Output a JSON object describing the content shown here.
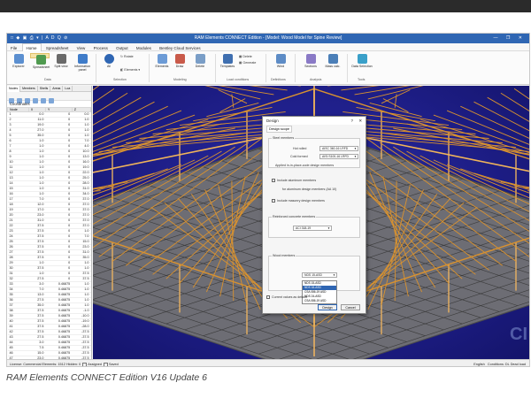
{
  "app": {
    "title": "RAM Elements CONNECT Edition - [Model: Wood Model for Spine Review]",
    "quick_access": "□ ◆ ▣ ⎙ ▾ | A D Q ⊘",
    "window_controls": "— ❐ ✕"
  },
  "menu": [
    "File",
    "Home",
    "Spreadsheet",
    "View",
    "Process",
    "Output",
    "Modules",
    "Bentley Cloud Services"
  ],
  "menu_active": "Home",
  "ribbon": {
    "buttons": [
      "Explorer",
      "Spreadsheet",
      "Split view",
      "Information panel",
      "All",
      "Elements",
      "Draw",
      "Delete",
      "Templates",
      "Add/Edit",
      "Generate",
      "Wind",
      "Sections",
      "Mass calc.",
      "Data Selection"
    ],
    "small_buttons": [
      "Rotate",
      "Elements ▾",
      "Delete",
      "Generate"
    ],
    "groups": [
      "Data",
      "Selection",
      "Modeling",
      "Load conditions",
      "Definitions",
      "Analysis",
      "Tools"
    ]
  },
  "left_panel": {
    "tabs": [
      "Nodes",
      "Members",
      "Shells",
      "Areas",
      "Loa"
    ],
    "heading": "Coordinates",
    "columns": [
      "Node",
      "X",
      "Y",
      "Z",
      "↓"
    ],
    "rows": [
      [
        "1",
        "0.0",
        "0",
        "0.0"
      ],
      [
        "2",
        "11.0",
        "0",
        "1.0"
      ],
      [
        "3",
        "19.0",
        "0",
        "1.0"
      ],
      [
        "4",
        "27.0",
        "0",
        "1.0"
      ],
      [
        "5",
        "35.0",
        "0",
        "1.0"
      ],
      [
        "6",
        "1.0",
        "0",
        "7.0"
      ],
      [
        "7",
        "1.0",
        "0",
        "4.0"
      ],
      [
        "8",
        "1.0",
        "0",
        "10.0"
      ],
      [
        "9",
        "1.0",
        "0",
        "13.0"
      ],
      [
        "10",
        "1.0",
        "0",
        "16.0"
      ],
      [
        "11",
        "1.0",
        "0",
        "19.0"
      ],
      [
        "12",
        "1.0",
        "0",
        "22.0"
      ],
      [
        "13",
        "1.0",
        "0",
        "25.0"
      ],
      [
        "14",
        "1.0",
        "0",
        "28.0"
      ],
      [
        "15",
        "1.0",
        "0",
        "31.0"
      ],
      [
        "16",
        "1.0",
        "0",
        "34.0"
      ],
      [
        "17",
        "7.0",
        "0",
        "37.0"
      ],
      [
        "18",
        "12.0",
        "0",
        "37.0"
      ],
      [
        "19",
        "17.0",
        "0",
        "37.0"
      ],
      [
        "20",
        "23.0",
        "0",
        "37.0"
      ],
      [
        "21",
        "31.0",
        "0",
        "37.0"
      ],
      [
        "22",
        "37.5",
        "0",
        "37.0"
      ],
      [
        "23",
        "37.5",
        "0",
        "1.0"
      ],
      [
        "24",
        "37.5",
        "0",
        "7.0"
      ],
      [
        "25",
        "37.5",
        "0",
        "15.0"
      ],
      [
        "26",
        "37.5",
        "0",
        "23.0"
      ],
      [
        "27",
        "37.5",
        "0",
        "31.0"
      ],
      [
        "28",
        "37.5",
        "0",
        "35.0"
      ],
      [
        "29",
        "1.0",
        "0",
        "1.0"
      ],
      [
        "30",
        "37.5",
        "0",
        "1.0"
      ],
      [
        "31",
        "1.0",
        "0",
        "37.5"
      ],
      [
        "32",
        "27.5",
        "0",
        "37.5"
      ],
      [
        "33",
        "3.0",
        "0.46875",
        "1.0"
      ],
      [
        "34",
        "7.0",
        "0.46875",
        "1.0"
      ],
      [
        "35",
        "13.0",
        "0.46875",
        "1.0"
      ],
      [
        "36",
        "27.5",
        "0.46875",
        "1.0"
      ],
      [
        "37",
        "35.0",
        "0.46875",
        "1.0"
      ],
      [
        "38",
        "37.5",
        "0.46875",
        "-1.0"
      ],
      [
        "39",
        "37.5",
        "0.46875",
        "-10.0"
      ],
      [
        "40",
        "37.5",
        "0.46875",
        "-19.0"
      ],
      [
        "41",
        "37.5",
        "0.46875",
        "-28.0"
      ],
      [
        "42",
        "37.5",
        "0.46875",
        "-37.5"
      ],
      [
        "43",
        "27.5",
        "0.46875",
        "-37.5"
      ],
      [
        "44",
        "3.0",
        "0.46875",
        "-37.5"
      ],
      [
        "45",
        "7.5",
        "0.46875",
        "-37.5"
      ],
      [
        "46",
        "15.0",
        "0.46875",
        "-37.5"
      ],
      [
        "47",
        "23.0",
        "0.46875",
        "-37.5"
      ],
      [
        "48",
        "31.0",
        "0.46875",
        "-37.5"
      ],
      [
        "49",
        "35.0",
        "0.46875",
        "-37.5"
      ],
      [
        "50",
        "1.0",
        "0.46875",
        "-37.5"
      ]
    ]
  },
  "dialog": {
    "title": "Design",
    "help": "?",
    "close": "✕",
    "tab": "Design scope",
    "group1": "Steel members",
    "label_steel": "Hot rolled",
    "value_steel": "AISC 360-16 LRFD",
    "label_cold": "Cold formed",
    "value_cold": "AISI S100-16 LRFD",
    "note": "Applied in-in-place-code design members",
    "check_aluminum": "Include aluminum members",
    "note2": "for aluminum design members (AA 10)",
    "check_masonry": "Include masonry design members",
    "group2": "Reinforced concrete members",
    "value_concrete": "ACI 318-19",
    "group3": "Wood members",
    "value_wood": "NDS 15-ASD",
    "options": [
      "NDS 15-ASD",
      "NDS 18-ASD",
      "CSA 086-19 ASD",
      "NDS 24-ASD",
      "CSA 086-19 ASD"
    ],
    "highlighted": "NDS 18-ASD",
    "check_default": "Current values as default",
    "ok": "Design",
    "cancel": "Cancel"
  },
  "status_bar": {
    "left": "License: Commercial   Elements: 1512  Hidden: 0",
    "assigned": "Assigned",
    "saved": "Saved",
    "units": "English",
    "conditions_label": "Conditions:",
    "condition_value": "DL Dead load"
  },
  "watermark": "CI",
  "caption": "RAM Elements CONNECT Edition V16 Update 6",
  "colors": {
    "titlebar": "#2f66b3",
    "viewport": "#1d1d85",
    "timber": "#d9922f",
    "column": "#e8b061",
    "grid_base": "#3a3a3a"
  }
}
